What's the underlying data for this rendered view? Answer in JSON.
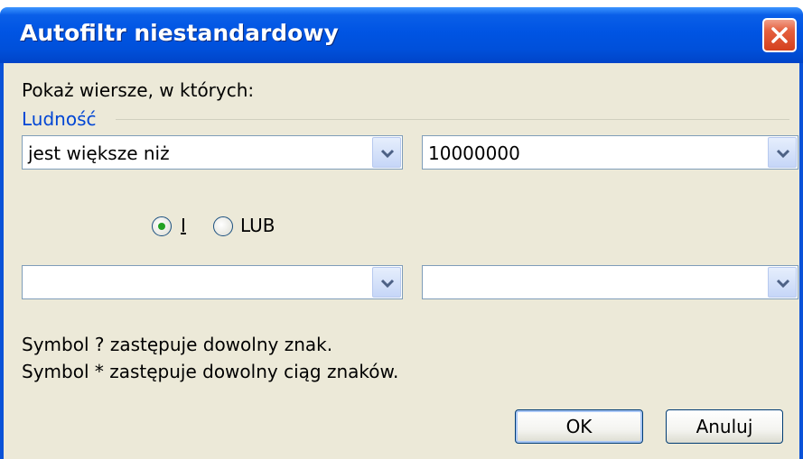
{
  "window": {
    "title": "Autofiltr niestandardowy"
  },
  "dialog": {
    "prompt": "Pokaż wiersze, w których:",
    "field_name": "Ludność",
    "condition1": {
      "operator": "jest większe niż",
      "value": "10000000"
    },
    "logic": {
      "and_label": "I",
      "or_label": "LUB",
      "selected": "I"
    },
    "condition2": {
      "operator": "",
      "value": ""
    },
    "hint1": "Symbol ? zastępuje dowolny znak.",
    "hint2": "Symbol * zastępuje dowolny ciąg znaków.",
    "ok_label": "OK",
    "cancel_label": "Anuluj"
  },
  "colors": {
    "titlebar": "#0054e3",
    "client_bg": "#ece9d8",
    "group_label": "#0046d5",
    "close": "#e5603f"
  },
  "icons": {
    "close": "close-icon",
    "dropdown": "chevron-down-icon"
  }
}
